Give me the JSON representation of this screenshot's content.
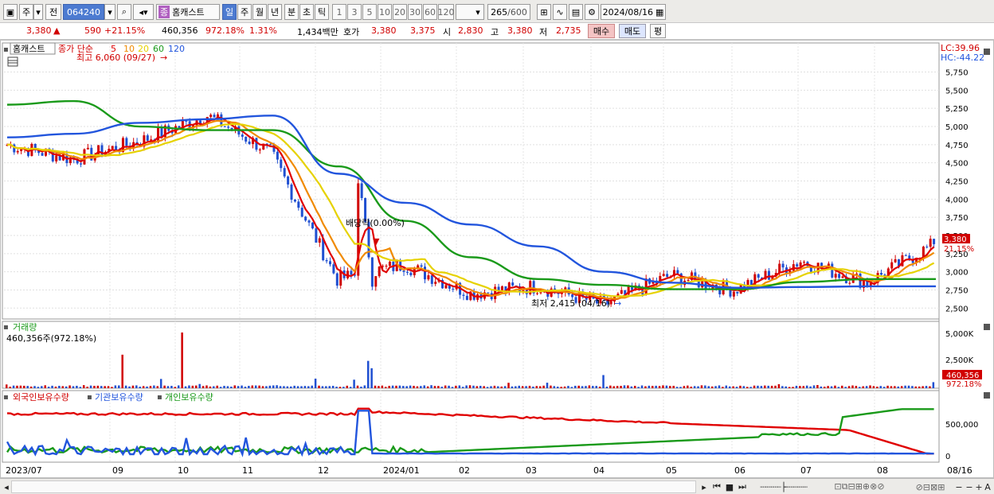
{
  "toolbar": {
    "period_type": "주",
    "prev_label": "전",
    "code": "064240",
    "stock_name": "홈캐스트",
    "stock_badge": "종",
    "periods": [
      "일",
      "주",
      "월",
      "년",
      "분",
      "초",
      "틱"
    ],
    "active_period": "일",
    "intervals": [
      "1",
      "3",
      "5",
      "10",
      "20",
      "30",
      "60",
      "120"
    ],
    "count": "265",
    "count_total": "/600",
    "date": "2024/08/16"
  },
  "quote": {
    "price": "3,380",
    "change_arrow": "▲",
    "change": "590",
    "change_pct": "+21.15%",
    "volume": "460,356",
    "volume_pct": "972.18%",
    "turnover_pct": "1.31%",
    "amount": "1,434백만",
    "hoga_label": "호가",
    "ask": "3,380",
    "bid": "3,375",
    "open_label": "시",
    "open": "2,830",
    "high_label": "고",
    "high": "3,380",
    "low_label": "저",
    "low": "2,735",
    "buy_label": "매수",
    "sell_label": "매도",
    "avg_label": "평"
  },
  "legend": {
    "name": "홈캐스트",
    "ma_prefix": "종가 단순",
    "ma_periods": [
      "5",
      "10",
      "20",
      "60",
      "120"
    ],
    "ma_colors": [
      "#e00000",
      "#f08a00",
      "#e6d200",
      "#1a9a1a",
      "#2255dd"
    ]
  },
  "lc_label": "LC:39.96",
  "hc_label": "HC:-44.22",
  "annotations": {
    "high_note": "최고 6,060 (09/27)",
    "low_note": "최저 2,415 (04/16)",
    "dividend_note": "배당락(0.00%)"
  },
  "price_tags": {
    "price": "3,380",
    "pct": "21.15%"
  },
  "volume_panel": {
    "title": "거래량",
    "value_label": "460,356주(972.18%)",
    "tag": "460,356",
    "tag_pct": "972.18%",
    "ticks": [
      "5,000K",
      "2,500K"
    ]
  },
  "holding_panel": {
    "foreign": "외국인보유수량",
    "institution": "기관보유수량",
    "individual": "개인보유수량",
    "ticks": [
      "500,000",
      "0"
    ]
  },
  "x_labels": [
    "2023/07",
    "09",
    "10",
    "11",
    "12",
    "2024/01",
    "02",
    "03",
    "04",
    "05",
    "06",
    "07",
    "08",
    "08/16"
  ],
  "y_ticks": [
    "5,750",
    "5,500",
    "5,250",
    "5,000",
    "4,750",
    "4,500",
    "4,250",
    "4,000",
    "3,750",
    "3,500",
    "3,250",
    "3,000",
    "2,750",
    "2,500"
  ],
  "chart_data": {
    "type": "line",
    "title": "홈캐스트 (064240) 일봉",
    "ylim": [
      2350,
      6150
    ],
    "x": [
      "2023/07",
      "2023/08",
      "2023/09",
      "2023/10",
      "2023/11",
      "2023/12",
      "2024/01",
      "2024/02",
      "2024/03",
      "2024/04",
      "2024/05",
      "2024/06",
      "2024/07",
      "2024/08",
      "2024/08/16"
    ],
    "series": [
      {
        "name": "종가",
        "values": [
          4750,
          4550,
          4800,
          5150,
          4650,
          2900,
          3100,
          2700,
          2800,
          2550,
          2950,
          2750,
          3150,
          2850,
          3380
        ]
      },
      {
        "name": "120",
        "values": [
          4850,
          4900,
          5050,
          5100,
          5150,
          4350,
          3950,
          3650,
          3350,
          3000,
          2850,
          2780,
          2790,
          2800,
          2800
        ]
      },
      {
        "name": "60",
        "values": [
          5300,
          5350,
          5000,
          4950,
          4950,
          4450,
          3700,
          3200,
          2900,
          2820,
          2760,
          2760,
          2860,
          2900,
          2900
        ]
      }
    ],
    "volume_k": [
      480,
      300,
      2550,
      920,
      260,
      2600,
      400,
      220,
      1250,
      350,
      380,
      220,
      700,
      260,
      460
    ]
  }
}
